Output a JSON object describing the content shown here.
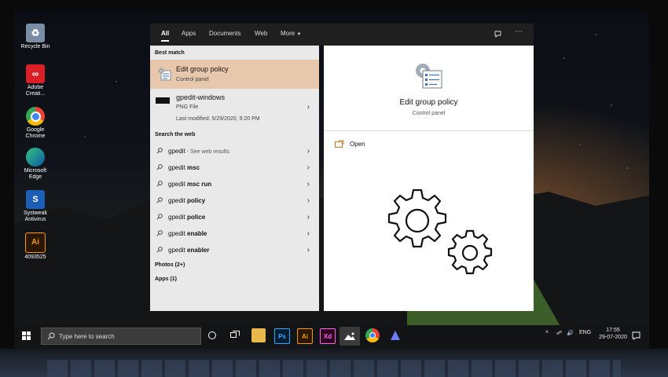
{
  "desktop": {
    "icons": [
      {
        "label": "Recycle Bin",
        "icon": "recycle-bin-icon"
      },
      {
        "label": "Adobe Creati...",
        "icon": "adobe-cc-icon"
      },
      {
        "label": "Google Chrome",
        "icon": "chrome-icon"
      },
      {
        "label": "Microsoft Edge",
        "icon": "edge-icon"
      },
      {
        "label": "Systweak Antivirus",
        "icon": "systweak-antivirus-icon"
      },
      {
        "label": "4093525",
        "icon": "illustrator-file-icon"
      }
    ]
  },
  "search": {
    "tabs": [
      "All",
      "Apps",
      "Documents",
      "Web",
      "More"
    ],
    "best_match_heading": "Best match",
    "best_match": {
      "title": "Edit group policy",
      "subtitle": "Control panel"
    },
    "file_result": {
      "title": "gpedit-windows",
      "type": "PNG File",
      "modified": "Last modified: 5/29/2020, 9:20 PM"
    },
    "web_heading": "Search the web",
    "web_results": [
      {
        "prefix": "gpedit",
        "bold": "",
        "note": " - See web results"
      },
      {
        "prefix": "gpedit ",
        "bold": "msc",
        "note": ""
      },
      {
        "prefix": "gpedit ",
        "bold": "msc run",
        "note": ""
      },
      {
        "prefix": "gpedit ",
        "bold": "policy",
        "note": ""
      },
      {
        "prefix": "gpedit ",
        "bold": "police",
        "note": ""
      },
      {
        "prefix": "gpedit ",
        "bold": "enable",
        "note": ""
      },
      {
        "prefix": "gpedit ",
        "bold": "enabler",
        "note": ""
      }
    ],
    "photos_label": "Photos (2+)",
    "apps_label": "Apps (1)",
    "preview": {
      "title": "Edit group policy",
      "subtitle": "Control panel",
      "open_label": "Open"
    }
  },
  "taskbar": {
    "search_placeholder": "Type here to search",
    "apps": [
      {
        "name": "file-explorer",
        "glyph": ""
      },
      {
        "name": "photoshop",
        "glyph": "Ps"
      },
      {
        "name": "illustrator",
        "glyph": "Ai"
      },
      {
        "name": "xd",
        "glyph": "Xd"
      },
      {
        "name": "photos",
        "glyph": ""
      },
      {
        "name": "chrome",
        "glyph": ""
      },
      {
        "name": "systweak",
        "glyph": ""
      }
    ],
    "language": "ENG",
    "time": "17:55",
    "date": "29-07-2020"
  },
  "colors": {
    "best_match_highlight": "#e8c8ad",
    "panel_bg": "#e9e9e9",
    "taskbar_bg": "#121416"
  }
}
